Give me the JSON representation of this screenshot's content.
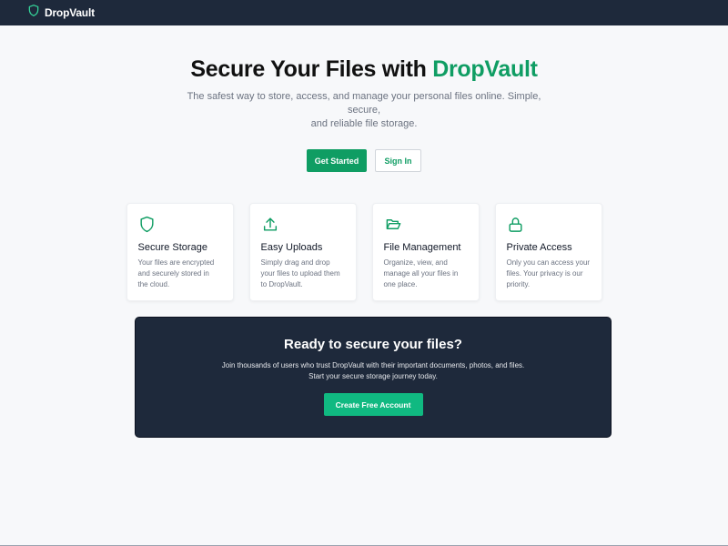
{
  "brand": {
    "name": "DropVault",
    "icon": "shield-icon",
    "icon_color": "#34d399"
  },
  "hero": {
    "title_prefix": "Secure Your Files with ",
    "title_accent": "DropVault",
    "subtitle_line1": "The safest way to store, access, and manage your personal files online. Simple, secure,",
    "subtitle_line2": "and reliable file storage.",
    "primary_label": "Get Started",
    "secondary_label": "Sign In"
  },
  "features": [
    {
      "icon": "shield-icon",
      "title": "Secure Storage",
      "lines": [
        "Your files are encrypted",
        "and securely stored in",
        "the cloud."
      ]
    },
    {
      "icon": "upload-icon",
      "title": "Easy Uploads",
      "lines": [
        "Simply drag and drop",
        "your files to upload them",
        "to DropVault."
      ]
    },
    {
      "icon": "folder-open-icon",
      "title": "File Management",
      "lines": [
        "Organize, view, and",
        "manage all your files in",
        "one place."
      ]
    },
    {
      "icon": "lock-icon",
      "title": "Private Access",
      "lines": [
        "Only you can access your",
        "files. Your privacy is our",
        "priority."
      ]
    }
  ],
  "cta": {
    "title": "Ready to secure your files?",
    "text_line1": "Join thousands of users who trust DropVault with their important documents, photos, and files.",
    "text_line2": "Start your secure storage journey today.",
    "button_label": "Create Free Account"
  },
  "colors": {
    "accent": "#0f9d63",
    "nav_bg": "#1e293b",
    "cta_button": "#10b981"
  }
}
